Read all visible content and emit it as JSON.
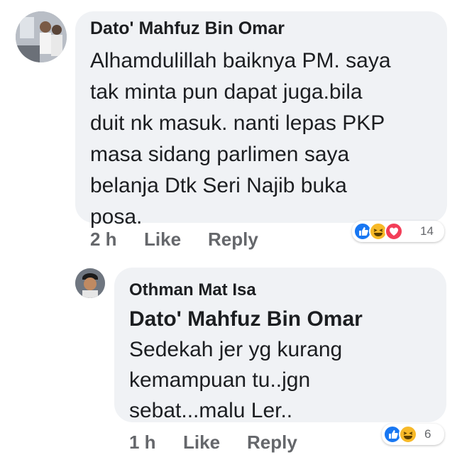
{
  "comment": {
    "author": "Dato' Mahfuz Bin Omar",
    "text": "Alhamdulillah baiknya PM. saya\ntak minta pun dapat juga.bila\nduit nk masuk. nanti lepas PKP\nmasa sidang parlimen saya\nbelanja Dtk Seri Najib buka\nposa.",
    "time": "2 h",
    "like_label": "Like",
    "reply_label": "Reply",
    "reaction_count": "14",
    "reactions": [
      "like-icon",
      "haha-icon",
      "love-icon"
    ]
  },
  "reply": {
    "author": "Othman Mat Isa",
    "mention": "Dato' Mahfuz Bin Omar",
    "text": "Sedekah jer yg kurang\nkemampuan tu..jgn\nsebat...malu Ler..",
    "time": "1 h",
    "like_label": "Like",
    "reply_label": "Reply",
    "reaction_count": "6",
    "reactions": [
      "like-icon",
      "haha-icon"
    ]
  },
  "colors": {
    "bubble": "#f0f2f5",
    "like": "#1877f2",
    "haha": "#f7b928",
    "love": "#f33e58",
    "muted": "#65676b"
  }
}
